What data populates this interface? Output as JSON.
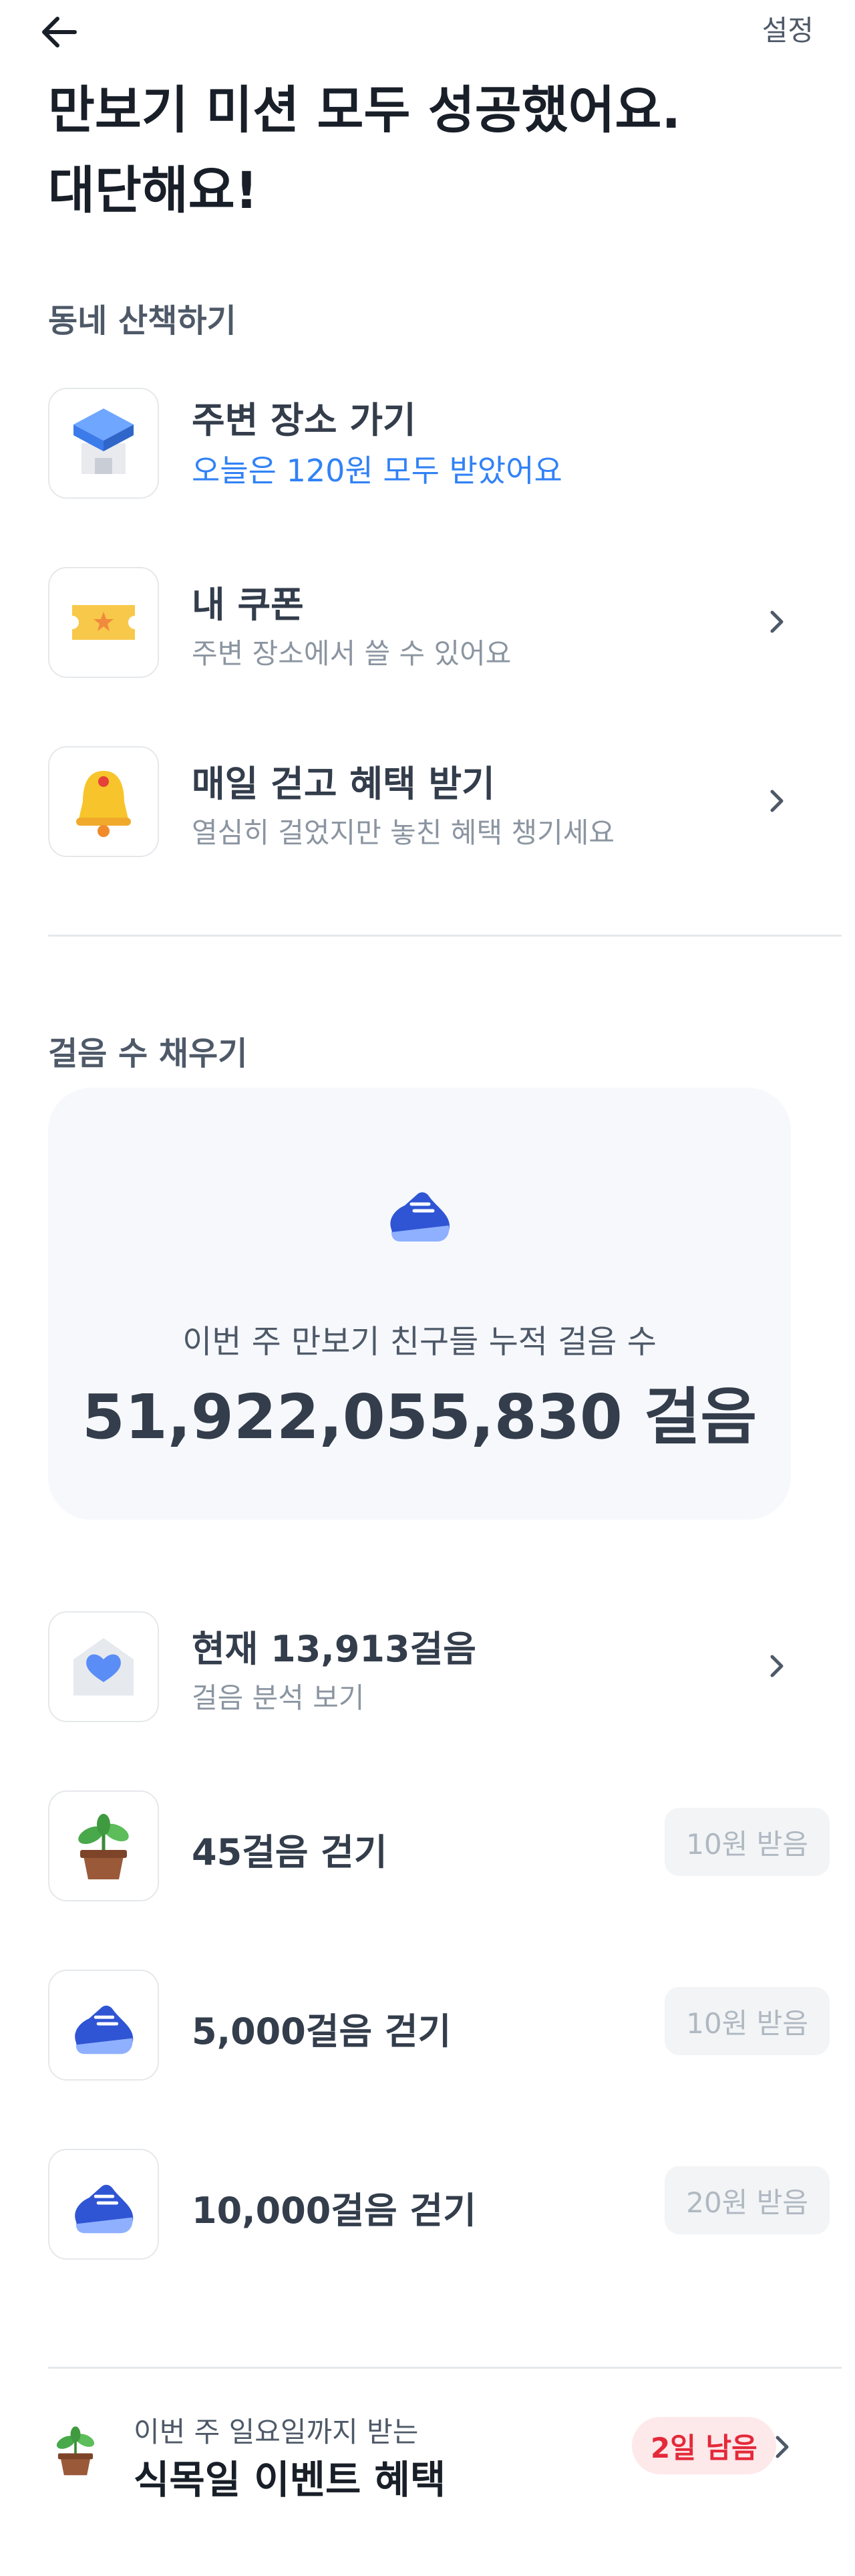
{
  "header": {
    "back_icon": "arrow-left-icon",
    "settings_label": "설정"
  },
  "headline": {
    "line1": "만보기 미션 모두 성공했어요.",
    "line2": "대단해요!"
  },
  "walk_section": {
    "title": "동네 산책하기",
    "items": [
      {
        "icon": "building-icon",
        "title": "주변 장소 가기",
        "subtitle": "오늘은 120원 모두 받았어요",
        "subtitle_color": "#3182f6",
        "has_chevron": false
      },
      {
        "icon": "ticket-icon",
        "title": "내 쿠폰",
        "subtitle": "주변 장소에서 쓸 수 있어요",
        "has_chevron": true
      },
      {
        "icon": "bell-icon",
        "title": "매일 걷고 혜택 받기",
        "subtitle": "열심히 걸었지만 놓친 혜택 챙기세요",
        "has_chevron": true
      }
    ]
  },
  "steps_section": {
    "title": "걸음 수 채우기",
    "card": {
      "icon": "sneaker-icon",
      "label": "이번 주 만보기 친구들 누적 걸음 수",
      "value": "51,922,055,830 걸음"
    },
    "current": {
      "icon": "envelope-heart-icon",
      "title": "현재 13,913걸음",
      "subtitle": "걸음 분석 보기"
    },
    "missions": [
      {
        "icon": "plant-icon",
        "title": "45걸음 걷기",
        "reward": "10원 받음"
      },
      {
        "icon": "sneaker-icon",
        "title": "5,000걸음 걷기",
        "reward": "10원 받음"
      },
      {
        "icon": "sneaker-icon",
        "title": "10,000걸음 걷기",
        "reward": "20원 받음"
      }
    ]
  },
  "event": {
    "icon": "plant-icon",
    "subtitle": "이번 주 일요일까지 받는",
    "title": "식목일 이벤트 혜택",
    "badge": "2일 남음"
  },
  "colors": {
    "accent_blue": "#3182f6",
    "badge_red": "#e42939",
    "card_bg": "#f6f8fc"
  }
}
